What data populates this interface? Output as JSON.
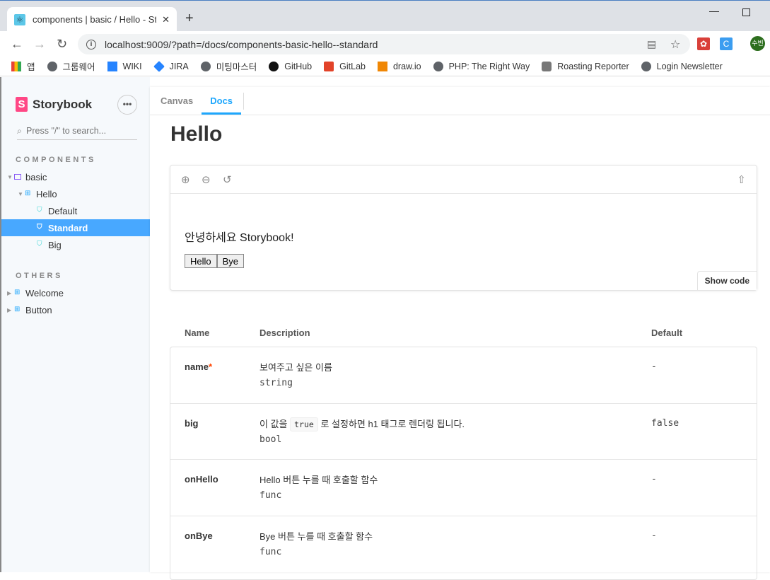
{
  "browser": {
    "tab_title": "components | basic / Hello - Storybook",
    "url": "localhost:9009/?path=/docs/components-basic-hello--standard",
    "profile": "수빈",
    "bookmarks": [
      "앱",
      "그룹웨어",
      "WIKI",
      "JIRA",
      "미팅마스터",
      "GitHub",
      "GitLab",
      "draw.io",
      "PHP: The Right Way",
      "Roasting Reporter",
      "Login Newsletter"
    ]
  },
  "sidebar": {
    "brand": "Storybook",
    "search_placeholder": "Press \"/\" to search...",
    "sections": [
      {
        "title": "COMPONENTS"
      },
      {
        "title": "OTHERS"
      }
    ],
    "items": [
      {
        "label": "basic",
        "type": "folder"
      },
      {
        "label": "Hello",
        "type": "component"
      },
      {
        "label": "Default",
        "type": "story"
      },
      {
        "label": "Standard",
        "type": "story",
        "selected": true
      },
      {
        "label": "Big",
        "type": "story"
      },
      {
        "label": "Welcome",
        "type": "component"
      },
      {
        "label": "Button",
        "type": "component"
      }
    ]
  },
  "main": {
    "tabs": [
      "Canvas",
      "Docs"
    ],
    "active_tab": "Docs",
    "title": "Hello",
    "preview": {
      "greeting": "안녕하세요 Storybook!",
      "buttons": [
        "Hello",
        "Bye"
      ],
      "show_code": "Show code"
    },
    "props": {
      "headers": [
        "Name",
        "Description",
        "Default"
      ],
      "rows": [
        {
          "name": "name",
          "required": "*",
          "desc": "보여주고 싶은 이름",
          "type": "string",
          "default": "-"
        },
        {
          "name": "big",
          "desc_pre": "이 값을",
          "desc_code": "true",
          "desc_post": "로 설정하면 h1 태그로 렌더링 됩니다.",
          "type": "bool",
          "default": "false"
        },
        {
          "name": "onHello",
          "desc": "Hello 버튼 누를 때 호출할 함수",
          "type": "func",
          "default": "-"
        },
        {
          "name": "onBye",
          "desc": "Bye 버튼 누를 때 호출할 함수",
          "type": "func",
          "default": "-"
        }
      ]
    }
  },
  "colors": {
    "accent": "#1ea7fd",
    "selected": "#48a8ff",
    "brand": "#ff4785"
  }
}
